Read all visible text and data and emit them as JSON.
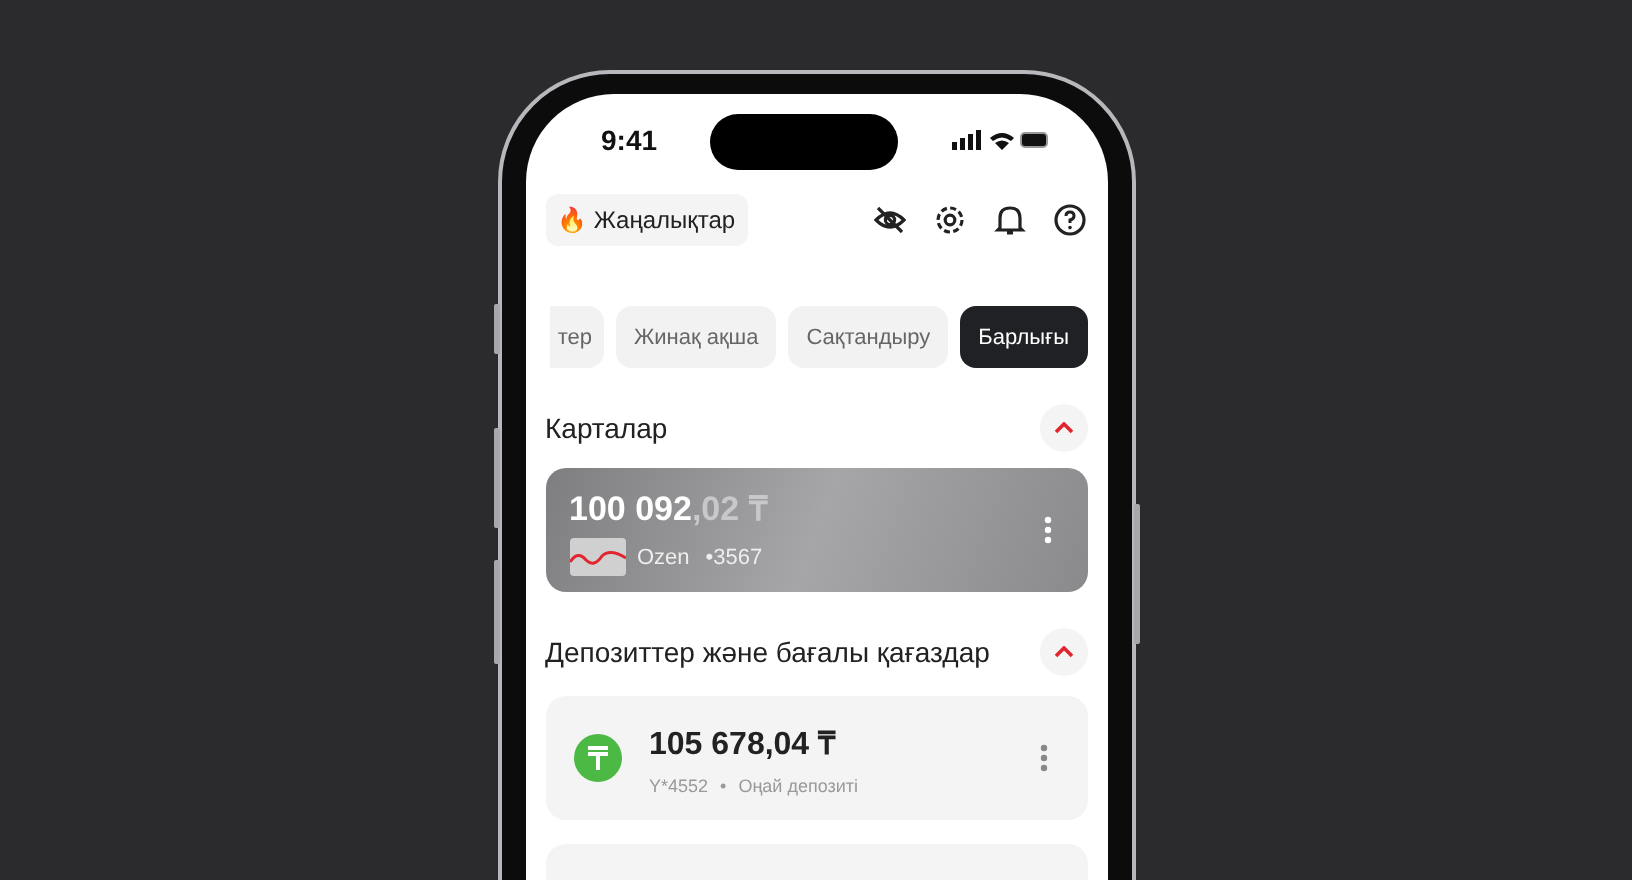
{
  "status_bar": {
    "time": "9:41"
  },
  "header": {
    "news_button": {
      "emoji": "🔥",
      "label": "Жаңалықтар"
    }
  },
  "filter_chips": [
    {
      "label": "тер",
      "selected": false
    },
    {
      "label": "Жинақ ақша",
      "selected": false
    },
    {
      "label": "Сақтандыру",
      "selected": false
    },
    {
      "label": "Барлығы",
      "selected": true
    }
  ],
  "sections": [
    {
      "title": "Карталар",
      "expanded": true,
      "kind": "cards",
      "items": [
        {
          "amount_main": "100 092",
          "amount_fraction": ",02 ₸",
          "name": "Ozen",
          "number": "•3567"
        }
      ]
    },
    {
      "title": "Депозиттер және бағалы қағаздар",
      "expanded": true,
      "kind": "deposits",
      "items": [
        {
          "amount": "105 678,04 ₸",
          "number": "Y*4552",
          "separator": "•",
          "name": "Оңай депозиті"
        }
      ]
    }
  ]
}
